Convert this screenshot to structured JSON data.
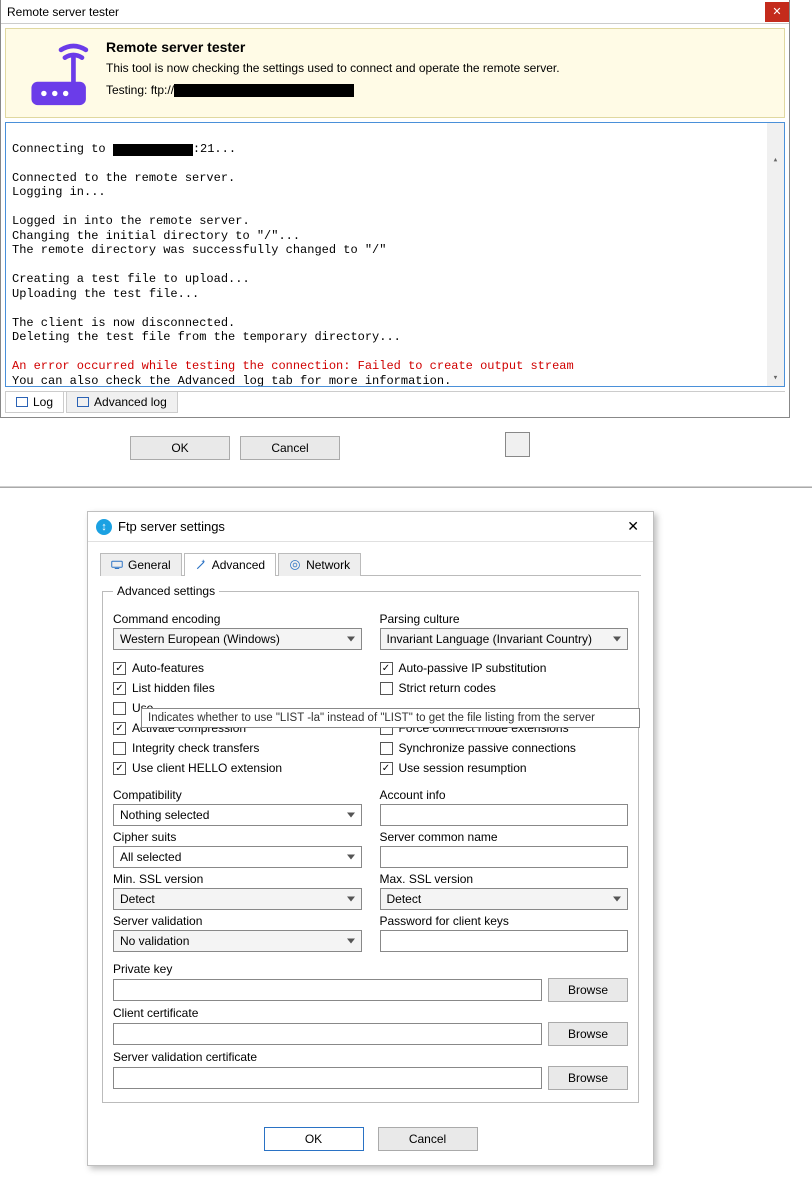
{
  "win1": {
    "title": "Remote server tester",
    "banner": {
      "title": "Remote server tester",
      "subtitle": "This tool is now checking the settings used to connect and operate the remote server.",
      "testing_prefix": "Testing: ftp://"
    },
    "log": {
      "connecting_prefix": "Connecting to ",
      "connecting_suffix": ":21...",
      "connected": "Connected to the remote server.",
      "logging_in": "Logging in...",
      "logged_in": "Logged in into the remote server.",
      "chdir": "Changing the initial directory to \"/\"...",
      "chdir_ok": "The remote directory was successfully changed to \"/\"",
      "create": "Creating a test file to upload...",
      "upload": "Uploading the test file...",
      "disc": "The client is now disconnected.",
      "del": "Deleting the test file from the temporary directory...",
      "err": "An error occurred while testing the connection: Failed to create output stream",
      "advtip": "You can also check the Advanced log tab for more information."
    },
    "tabs": {
      "log": "Log",
      "advanced": "Advanced log"
    },
    "buttons": {
      "ok": "OK",
      "cancel": "Cancel"
    }
  },
  "win2": {
    "title": "Ftp server settings",
    "tabs": {
      "general": "General",
      "advanced": "Advanced",
      "network": "Network"
    },
    "legend": "Advanced settings",
    "cmd_encoding": {
      "label": "Command encoding",
      "value": "Western European (Windows)"
    },
    "parsing_culture": {
      "label": "Parsing culture",
      "value": "Invariant Language (Invariant Country)"
    },
    "chk": {
      "auto_features": "Auto-features",
      "list_hidden": "List hidden files",
      "use": "Use ",
      "activate_comp": "Activate compression",
      "integrity": "Integrity check transfers",
      "hello": "Use client HELLO extension",
      "auto_passive": "Auto-passive IP substitution",
      "strict": "Strict return codes",
      "force_connect": "Force connect mode extensions",
      "sync_passive": "Synchronize passive connections",
      "session_resume": "Use session resumption"
    },
    "tooltip": "Indicates whether to use \"LIST -la\" instead of \"LIST\" to get the file listing from the server",
    "compat": {
      "label": "Compatibility",
      "value": "Nothing selected"
    },
    "account": {
      "label": "Account info",
      "value": ""
    },
    "cipher": {
      "label": "Cipher suits",
      "value": "All selected"
    },
    "server_cn": {
      "label": "Server common name",
      "value": ""
    },
    "min_ssl": {
      "label": "Min. SSL version",
      "value": "Detect"
    },
    "max_ssl": {
      "label": "Max. SSL version",
      "value": "Detect"
    },
    "server_val": {
      "label": "Server validation",
      "value": "No validation"
    },
    "pwd": {
      "label": "Password for client keys",
      "value": ""
    },
    "priv_key": {
      "label": "Private key",
      "value": ""
    },
    "client_cert": {
      "label": "Client certificate",
      "value": ""
    },
    "server_val_cert": {
      "label": "Server validation certificate",
      "value": ""
    },
    "browse": "Browse",
    "buttons": {
      "ok": "OK",
      "cancel": "Cancel"
    }
  }
}
